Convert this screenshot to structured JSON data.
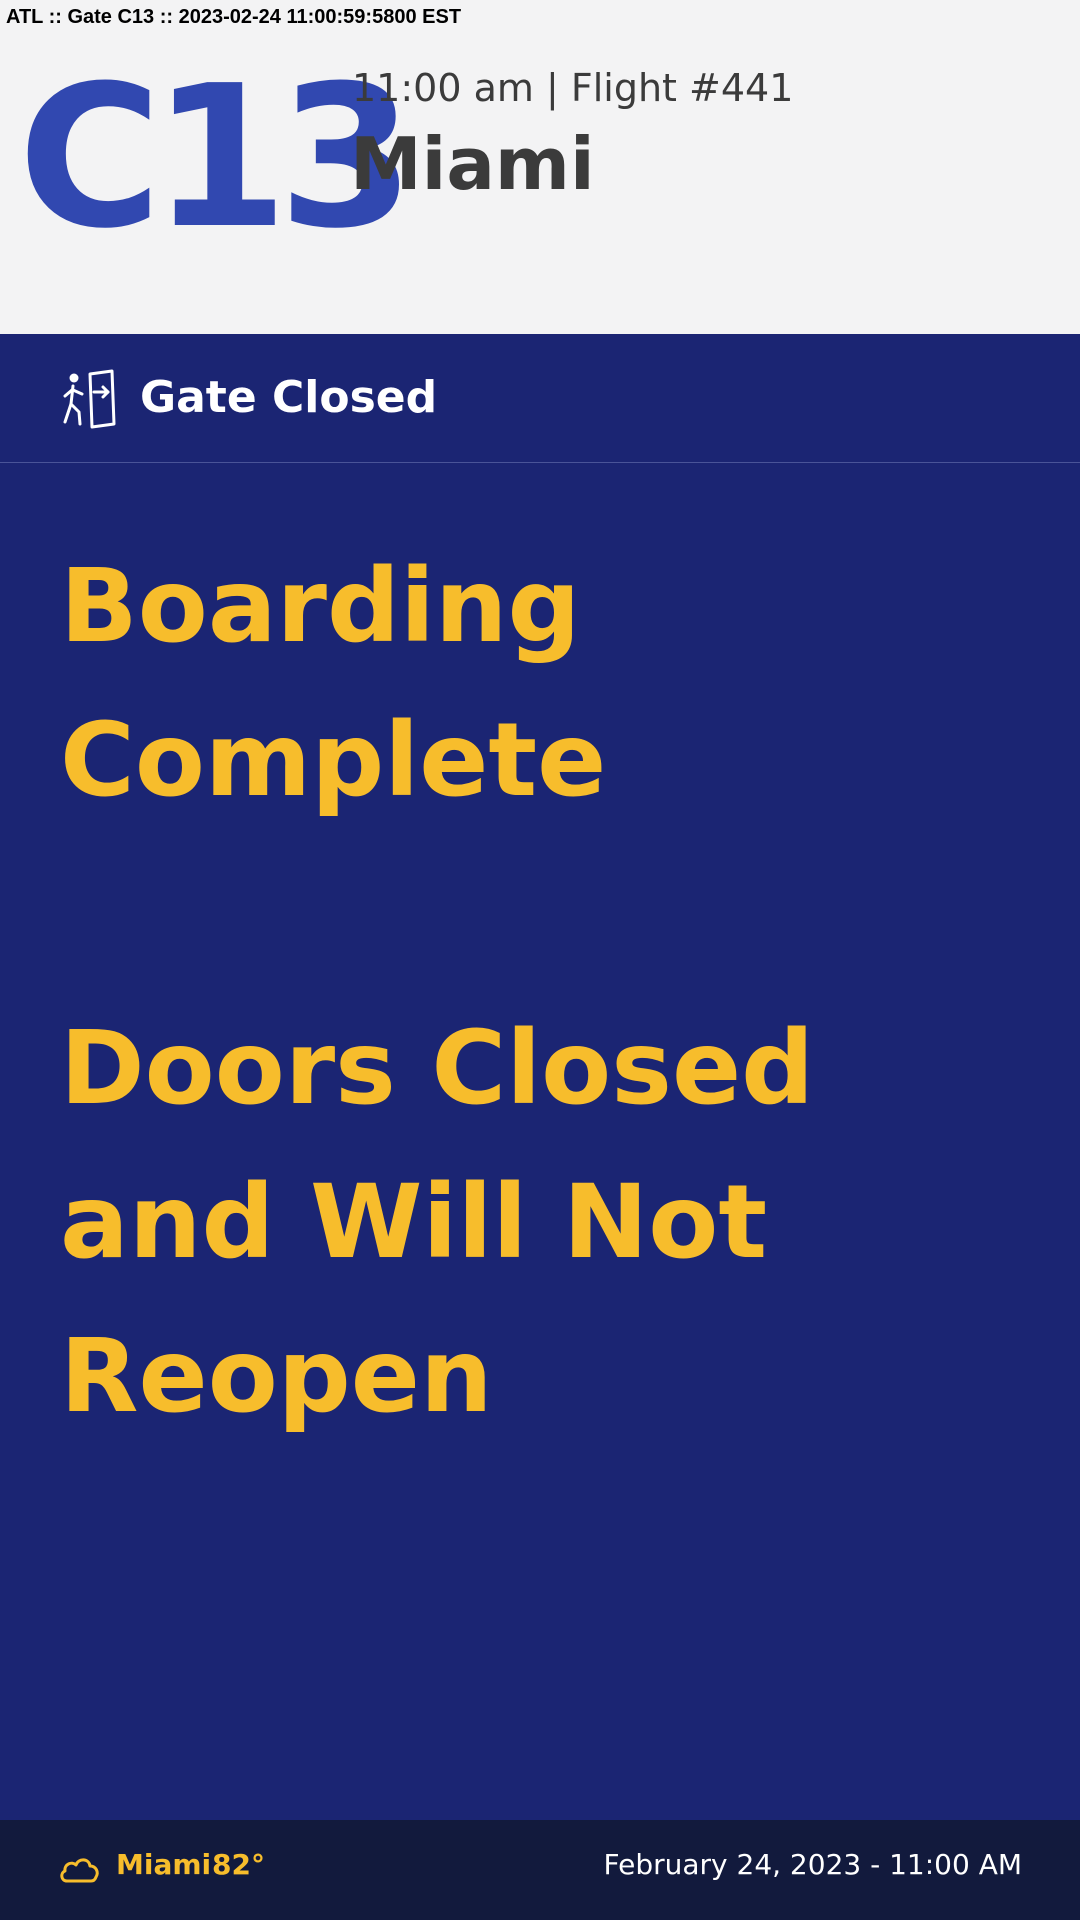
{
  "debug": {
    "text": "ATL :: Gate C13 :: 2023-02-24 11:00:59:5800 EST"
  },
  "header": {
    "gate": "C13",
    "flight_line": "11:00 am | Flight #441",
    "destination": "Miami"
  },
  "status": {
    "icon": "exit-door-icon",
    "text": "Gate Closed"
  },
  "messages": [
    {
      "lines": [
        "Boarding",
        "Complete"
      ]
    },
    {
      "lines": [
        "Doors Closed",
        "and Will Not",
        "Reopen"
      ]
    }
  ],
  "footer": {
    "weather_icon": "cloud-icon",
    "weather_city": "Miami",
    "weather_temp": "82°",
    "datetime": "February 24, 2023 - 11:00 AM"
  },
  "colors": {
    "gate_blue": "#3148b0",
    "panel_navy": "#1b2573",
    "footer_navy": "#121a3d",
    "accent_yellow": "#f7bd2c",
    "header_bg": "#f3f3f4",
    "header_text": "#3b3b3b"
  }
}
